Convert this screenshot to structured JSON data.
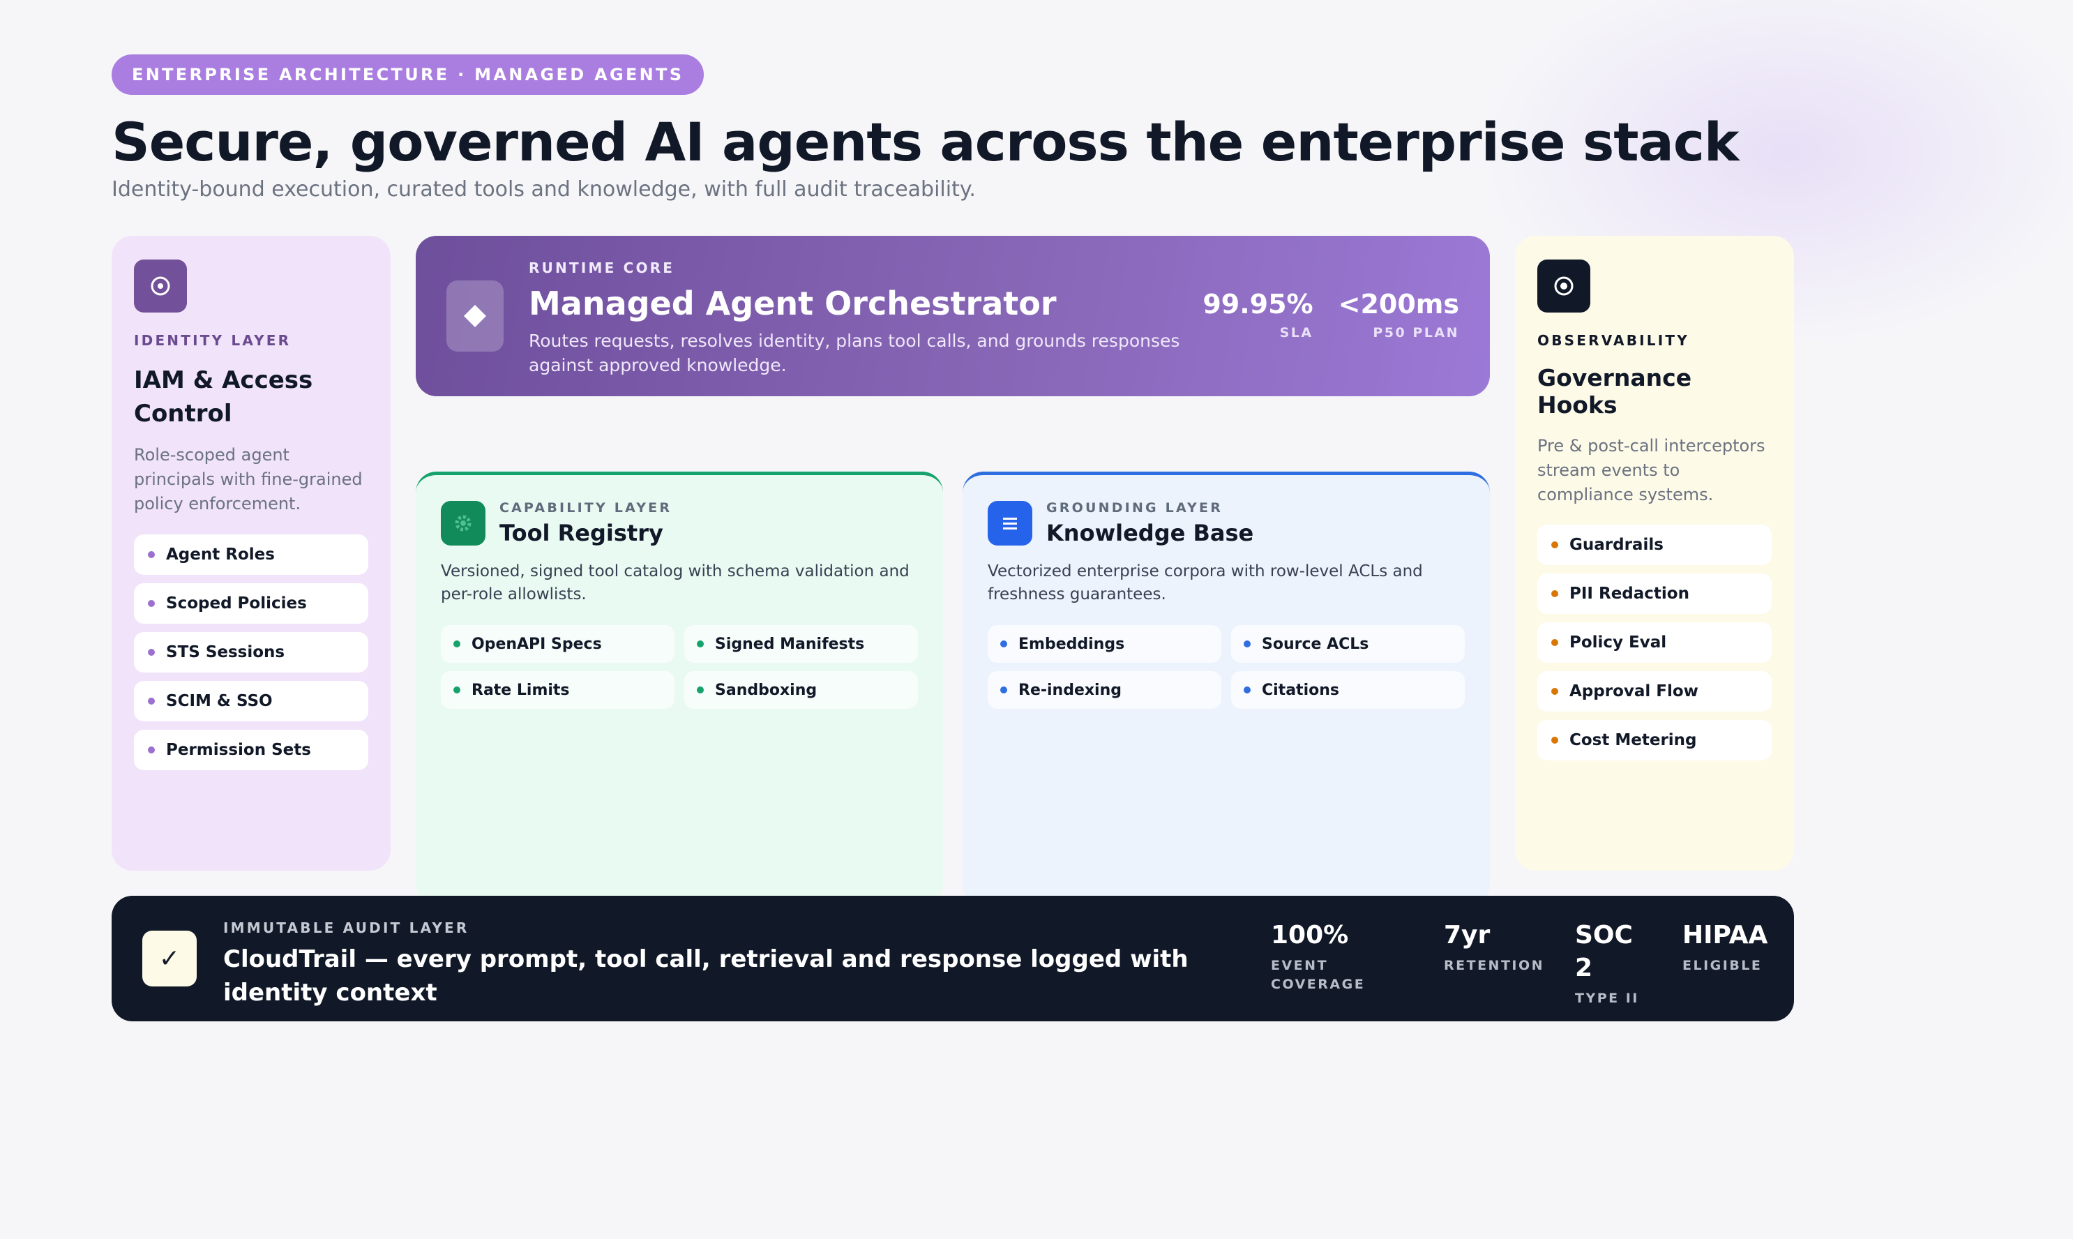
{
  "header": {
    "eyebrow": "ENTERPRISE ARCHITECTURE · MANAGED AGENTS",
    "title": "Secure, governed AI agents across the enterprise stack",
    "subtitle": "Identity-bound execution, curated tools and knowledge, with full audit traceability."
  },
  "identity": {
    "icon": "target-icon",
    "label": "IDENTITY LAYER",
    "title": "IAM & Access Control",
    "description": "Role-scoped agent principals with fine-grained policy enforcement.",
    "items": [
      "Agent Roles",
      "Scoped Policies",
      "STS Sessions",
      "SCIM & SSO",
      "Permission Sets"
    ]
  },
  "orchestrator": {
    "icon": "diamond-icon",
    "label": "RUNTIME CORE",
    "title": "Managed Agent Orchestrator",
    "description": "Routes requests, resolves identity, plans tool calls, and grounds responses against approved knowledge.",
    "metrics": [
      {
        "value": "99.95%",
        "label": "SLA"
      },
      {
        "value": "<200ms",
        "label": "P50 PLAN"
      }
    ]
  },
  "tools": {
    "icon": "gear-icon",
    "label": "CAPABILITY LAYER",
    "title": "Tool Registry",
    "description": "Versioned, signed tool catalog with schema validation and per-role allowlists.",
    "items": [
      "OpenAPI Specs",
      "Signed Manifests",
      "Rate Limits",
      "Sandboxing"
    ]
  },
  "knowledge": {
    "icon": "list-icon",
    "label": "GROUNDING LAYER",
    "title": "Knowledge Base",
    "description": "Vectorized enterprise corpora with row-level ACLs and freshness guarantees.",
    "items": [
      "Embeddings",
      "Source ACLs",
      "Re-indexing",
      "Citations"
    ]
  },
  "governance": {
    "icon": "eye-target-icon",
    "label": "OBSERVABILITY",
    "title": "Governance Hooks",
    "description": "Pre & post-call interceptors stream events to compliance systems.",
    "items": [
      "Guardrails",
      "PII Redaction",
      "Policy Eval",
      "Approval Flow",
      "Cost Metering"
    ]
  },
  "audit": {
    "icon": "check-icon",
    "label": "IMMUTABLE AUDIT LAYER",
    "title": "CloudTrail — every prompt, tool call, retrieval and response logged with identity context",
    "stats": [
      {
        "value": "100%",
        "label": "EVENT COVERAGE"
      },
      {
        "value": "7yr",
        "label": "RETENTION"
      },
      {
        "value": "SOC 2",
        "label": "TYPE II"
      },
      {
        "value": "HIPAA",
        "label": "ELIGIBLE"
      }
    ]
  },
  "colors": {
    "accent_purple": "#a97ee0",
    "tool_green": "#16a36b",
    "knowledge_blue": "#2f6ee0",
    "governance_orange": "#d97706",
    "audit_dark": "#111827"
  }
}
